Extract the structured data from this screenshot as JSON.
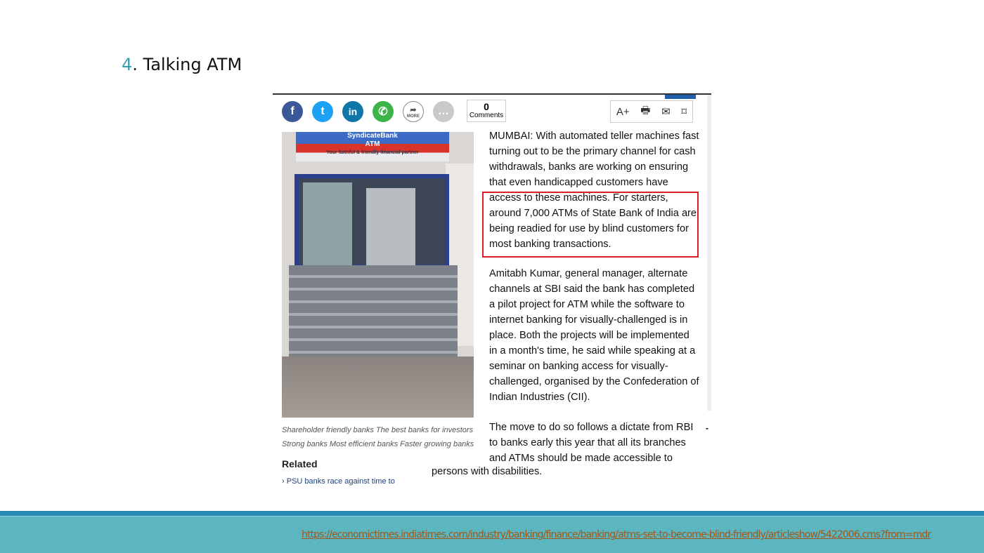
{
  "slide": {
    "number": "4",
    "title": ". Talking ATM"
  },
  "toolbar": {
    "comments_count": "0",
    "comments_label": "Comments",
    "more_label": "MORE",
    "font_label": "A+"
  },
  "photo": {
    "sign_text": "SyndicateBank",
    "sign_sub": "ATM",
    "tagline": "Your faithful & friendly financial partner"
  },
  "caption": {
    "line1": "Shareholder friendly banks The best banks for investors",
    "line2": "Strong banks Most efficient banks Faster growing banks"
  },
  "related": {
    "heading": "Related",
    "link": "PSU banks race against time to"
  },
  "article": {
    "p1a": "MUMBAI: With automated teller machines fast turning out to be the primary channel for cash withdrawals, banks are working on ensuring that even handicapped customers",
    "p1b": "have access to these machines. For starters, around 7,000 ATMs of State Bank of India are being readied for use by blind customers for most banking transactions.",
    "p2": "Amitabh Kumar, general manager, alternate channels at SBI said the bank has completed a pilot project for ATM while the software to internet banking for visually-challenged is in place. Both the projects will be implemented in a month's time, he said while speaking at a seminar on banking access for visually-challenged, organised by the Confederation of Indian Industries (CII).",
    "p3": "The move to do so follows a dictate from RBI to banks early this year that all its branches and ATMs should be made accessible to",
    "p3end": "persons with disabilities."
  },
  "footer": {
    "url": "https://economictimes.indiatimes.com/industry/banking/finance/banking/atms-set-to-become-blind-friendly/articleshow/5422006.cms?from=mdr"
  },
  "colors": {
    "accent": "#3aa0b0",
    "footer": "#5bb6bf",
    "highlight": "#d8222a"
  }
}
